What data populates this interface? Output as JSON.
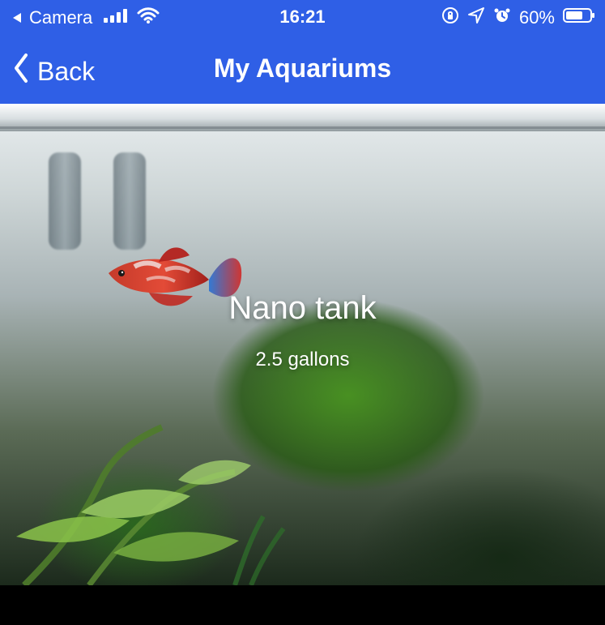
{
  "status_bar": {
    "back_app": "Camera",
    "time": "16:21",
    "battery_percent": "60%"
  },
  "nav": {
    "back_label": "Back",
    "title": "My Aquariums"
  },
  "aquarium": {
    "name": "Nano tank",
    "volume": "2.5 gallons"
  },
  "colors": {
    "header_blue": "#2f5fe6",
    "text_white": "#ffffff"
  },
  "icons": {
    "status": [
      "back-triangle-icon",
      "cellular-signal-icon",
      "wifi-icon",
      "screen-rotation-lock-icon",
      "location-arrow-icon",
      "alarm-clock-icon",
      "battery-icon"
    ],
    "nav": [
      "chevron-left-icon"
    ]
  }
}
